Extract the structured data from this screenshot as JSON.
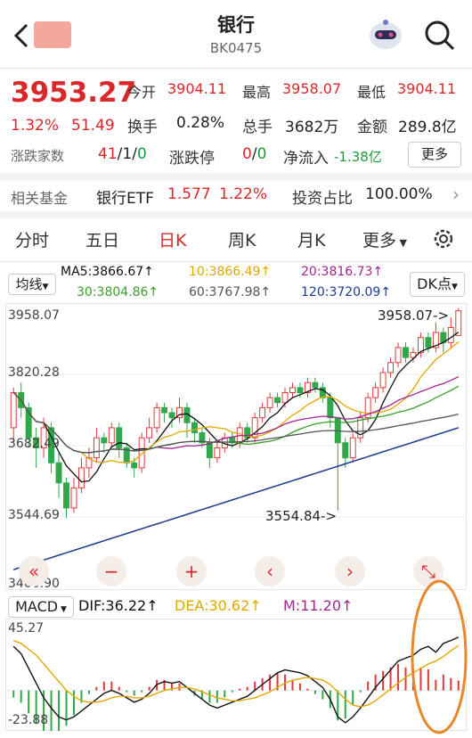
{
  "header": {
    "title": "银行",
    "code": "BK0475",
    "back_icon": "chevron-left-icon",
    "search_icon": "search-icon",
    "avatar": "robot-avatar"
  },
  "quote": {
    "price": "3953.27",
    "pct": "1.32%",
    "change": "51.49",
    "open_label": "今开",
    "open": "3904.11",
    "high_label": "最高",
    "high": "3958.07",
    "low_label": "最低",
    "low": "3904.11",
    "turnover_label": "换手",
    "turnover": "0.28%",
    "volume_label": "总手",
    "volume": "3682万",
    "amount_label": "金额",
    "amount": "289.8亿",
    "breadth_label": "涨跌家数",
    "breadth_up": "41",
    "breadth_flat": "1",
    "breadth_down": "0",
    "limit_label": "涨跌停",
    "limit_up": "0",
    "limit_down": "0",
    "netflow_label": "净流入",
    "netflow": "-1.38亿",
    "more_label": "更多"
  },
  "fund": {
    "label": "相关基金",
    "name": "银行ETF",
    "price": "1.577",
    "pct": "1.22%",
    "ratio_label": "投资占比",
    "ratio": "100.00%"
  },
  "tabs": [
    "分时",
    "五日",
    "日K",
    "周K",
    "月K",
    "更多"
  ],
  "active_tab": 2,
  "ma": {
    "selector": "均线",
    "ma5": "MA5:3866.67↑",
    "ma10": "10:3866.49↑",
    "ma20": "20:3816.73↑",
    "ma30": "30:3804.86↑",
    "ma60": "60:3767.98↑",
    "ma120": "120:3720.09↑",
    "dk": "DK点",
    "colors": {
      "ma5": "#111111",
      "ma10": "#e0a800",
      "ma20": "#a0278f",
      "ma30": "#3aa02a",
      "ma60": "#555555",
      "ma120": "#1f3a8c"
    }
  },
  "axis": {
    "top": "3958.07",
    "upper": "3820.28",
    "mid": "3682.49",
    "lower": "3544.69",
    "bottom": "3406.90",
    "max_mark": "3958.07->",
    "min_mark": "3554.84->"
  },
  "controls": [
    "«",
    "−",
    "+",
    "‹",
    "›",
    "⤡"
  ],
  "macd": {
    "selector": "MACD",
    "dif": "DIF:36.22↑",
    "dea": "DEA:30.62↑",
    "m": "M:11.20↑",
    "top": "45.27",
    "bottom": "-23.88"
  },
  "chart_data": {
    "type": "candlestick",
    "title": "",
    "ylim": [
      3406.9,
      3958.07
    ],
    "candles": [
      [
        3720,
        3790,
        3690,
        3800
      ],
      [
        3790,
        3760,
        3740,
        3810
      ],
      [
        3760,
        3700,
        3680,
        3770
      ],
      [
        3700,
        3680,
        3640,
        3720
      ],
      [
        3680,
        3720,
        3660,
        3740
      ],
      [
        3720,
        3650,
        3630,
        3730
      ],
      [
        3650,
        3610,
        3580,
        3670
      ],
      [
        3610,
        3560,
        3540,
        3620
      ],
      [
        3560,
        3600,
        3550,
        3620
      ],
      [
        3600,
        3640,
        3590,
        3660
      ],
      [
        3640,
        3660,
        3620,
        3680
      ],
      [
        3660,
        3700,
        3650,
        3720
      ],
      [
        3700,
        3690,
        3670,
        3710
      ],
      [
        3690,
        3720,
        3680,
        3730
      ],
      [
        3720,
        3680,
        3660,
        3730
      ],
      [
        3680,
        3650,
        3640,
        3690
      ],
      [
        3650,
        3640,
        3620,
        3660
      ],
      [
        3640,
        3700,
        3630,
        3710
      ],
      [
        3700,
        3720,
        3690,
        3740
      ],
      [
        3720,
        3760,
        3710,
        3770
      ],
      [
        3760,
        3750,
        3730,
        3770
      ],
      [
        3750,
        3740,
        3720,
        3760
      ],
      [
        3740,
        3760,
        3730,
        3780
      ],
      [
        3760,
        3730,
        3700,
        3770
      ],
      [
        3730,
        3710,
        3690,
        3740
      ],
      [
        3710,
        3690,
        3680,
        3720
      ],
      [
        3690,
        3660,
        3640,
        3700
      ],
      [
        3660,
        3680,
        3650,
        3690
      ],
      [
        3680,
        3700,
        3670,
        3710
      ],
      [
        3700,
        3690,
        3680,
        3710
      ],
      [
        3690,
        3720,
        3680,
        3730
      ],
      [
        3720,
        3700,
        3690,
        3730
      ],
      [
        3700,
        3740,
        3690,
        3750
      ],
      [
        3740,
        3760,
        3730,
        3770
      ],
      [
        3760,
        3780,
        3750,
        3790
      ],
      [
        3780,
        3770,
        3760,
        3790
      ],
      [
        3770,
        3790,
        3760,
        3800
      ],
      [
        3790,
        3800,
        3780,
        3810
      ],
      [
        3800,
        3790,
        3780,
        3810
      ],
      [
        3790,
        3810,
        3780,
        3820
      ],
      [
        3810,
        3800,
        3790,
        3820
      ],
      [
        3800,
        3780,
        3770,
        3810
      ],
      [
        3780,
        3740,
        3720,
        3790
      ],
      [
        3740,
        3690,
        3554.84,
        3740
      ],
      [
        3690,
        3660,
        3640,
        3700
      ],
      [
        3660,
        3700,
        3650,
        3710
      ],
      [
        3700,
        3740,
        3690,
        3750
      ],
      [
        3740,
        3780,
        3730,
        3790
      ],
      [
        3780,
        3800,
        3770,
        3810
      ],
      [
        3800,
        3830,
        3790,
        3840
      ],
      [
        3830,
        3850,
        3820,
        3860
      ],
      [
        3850,
        3880,
        3840,
        3890
      ],
      [
        3880,
        3860,
        3850,
        3890
      ],
      [
        3860,
        3870,
        3850,
        3880
      ],
      [
        3870,
        3900,
        3860,
        3910
      ],
      [
        3900,
        3880,
        3870,
        3910
      ],
      [
        3880,
        3910,
        3870,
        3930
      ],
      [
        3910,
        3890,
        3870,
        3920
      ],
      [
        3890,
        3920,
        3880,
        3940
      ],
      [
        3904.11,
        3953.27,
        3904.11,
        3958.07
      ]
    ],
    "macd_dif": [
      30,
      25,
      15,
      5,
      -5,
      -12,
      -18,
      -20,
      -18,
      -14,
      -10,
      -6,
      -2,
      0,
      -2,
      -5,
      -8,
      -6,
      -2,
      4,
      6,
      5,
      6,
      2,
      -2,
      -6,
      -10,
      -12,
      -10,
      -8,
      -6,
      -4,
      0,
      4,
      8,
      12,
      14,
      13,
      12,
      10,
      6,
      2,
      -6,
      -18,
      -22,
      -18,
      -12,
      -5,
      2,
      8,
      14,
      20,
      22,
      24,
      28,
      30,
      26,
      32,
      34,
      36.22
    ],
    "macd_dea": [
      34,
      32,
      28,
      24,
      18,
      12,
      6,
      0,
      -4,
      -7,
      -8,
      -8,
      -7,
      -5,
      -4,
      -4,
      -5,
      -5,
      -4,
      -2,
      0,
      1,
      2,
      2,
      1,
      -1,
      -3,
      -5,
      -6,
      -7,
      -7,
      -6,
      -5,
      -3,
      -1,
      2,
      5,
      7,
      8,
      9,
      8,
      7,
      4,
      -1,
      -6,
      -10,
      -11,
      -10,
      -7,
      -3,
      1,
      5,
      9,
      12,
      15,
      18,
      20,
      23,
      27,
      30.62
    ]
  }
}
